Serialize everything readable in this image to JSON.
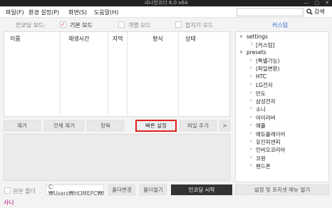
{
  "window": {
    "title": "샤나인코더 6.0 x64",
    "minimize": "—",
    "maximize": "▢",
    "close": "✕"
  },
  "menu": {
    "file": "파일(F)",
    "settings": "환경 설정(P)",
    "screen": "화면(S)",
    "help": "도움말(H)"
  },
  "search": {
    "label": "검색",
    "value": ""
  },
  "modes": {
    "label": "인코딩 모드:",
    "basic": "기본 모드",
    "basic_checked": true,
    "individual": "개별 모드",
    "individual_checked": false,
    "merge": "합치기 모드",
    "merge_checked": false,
    "custom": "커스텀"
  },
  "table": {
    "columns": [
      "이름",
      "재생시간",
      "자막",
      "형식",
      "상태"
    ],
    "rows": []
  },
  "tree": {
    "settings": {
      "label": "settings",
      "children": [
        "[커스텀]"
      ]
    },
    "presets": {
      "label": "presets",
      "children": [
        "(특별기능)",
        "(파일변환)",
        "HTC",
        "LG전자",
        "만도",
        "삼성전자",
        "소니",
        "아이리버",
        "애플",
        "에듀플레이어",
        "유진피엔피",
        "인비오코리아",
        "코원",
        "팬드폰"
      ]
    }
  },
  "actions": {
    "remove": "제거",
    "remove_all": "전체 제거",
    "item": "항목",
    "quick_settings": "빠른 설정",
    "add_file": "파일 추가",
    "more": ">"
  },
  "bottom": {
    "original_folder": "원본 폴더",
    "original_folder_checked": false,
    "folder_path": "C:₩Users₩HOMEPC₩I",
    "change_folder": "폴더변경",
    "open_folder": "폴더열기",
    "start_encoding": "인코딩 시작",
    "open_menu": "설정 및 프리셋 메뉴 열기"
  },
  "status": {
    "text": "샤나"
  }
}
